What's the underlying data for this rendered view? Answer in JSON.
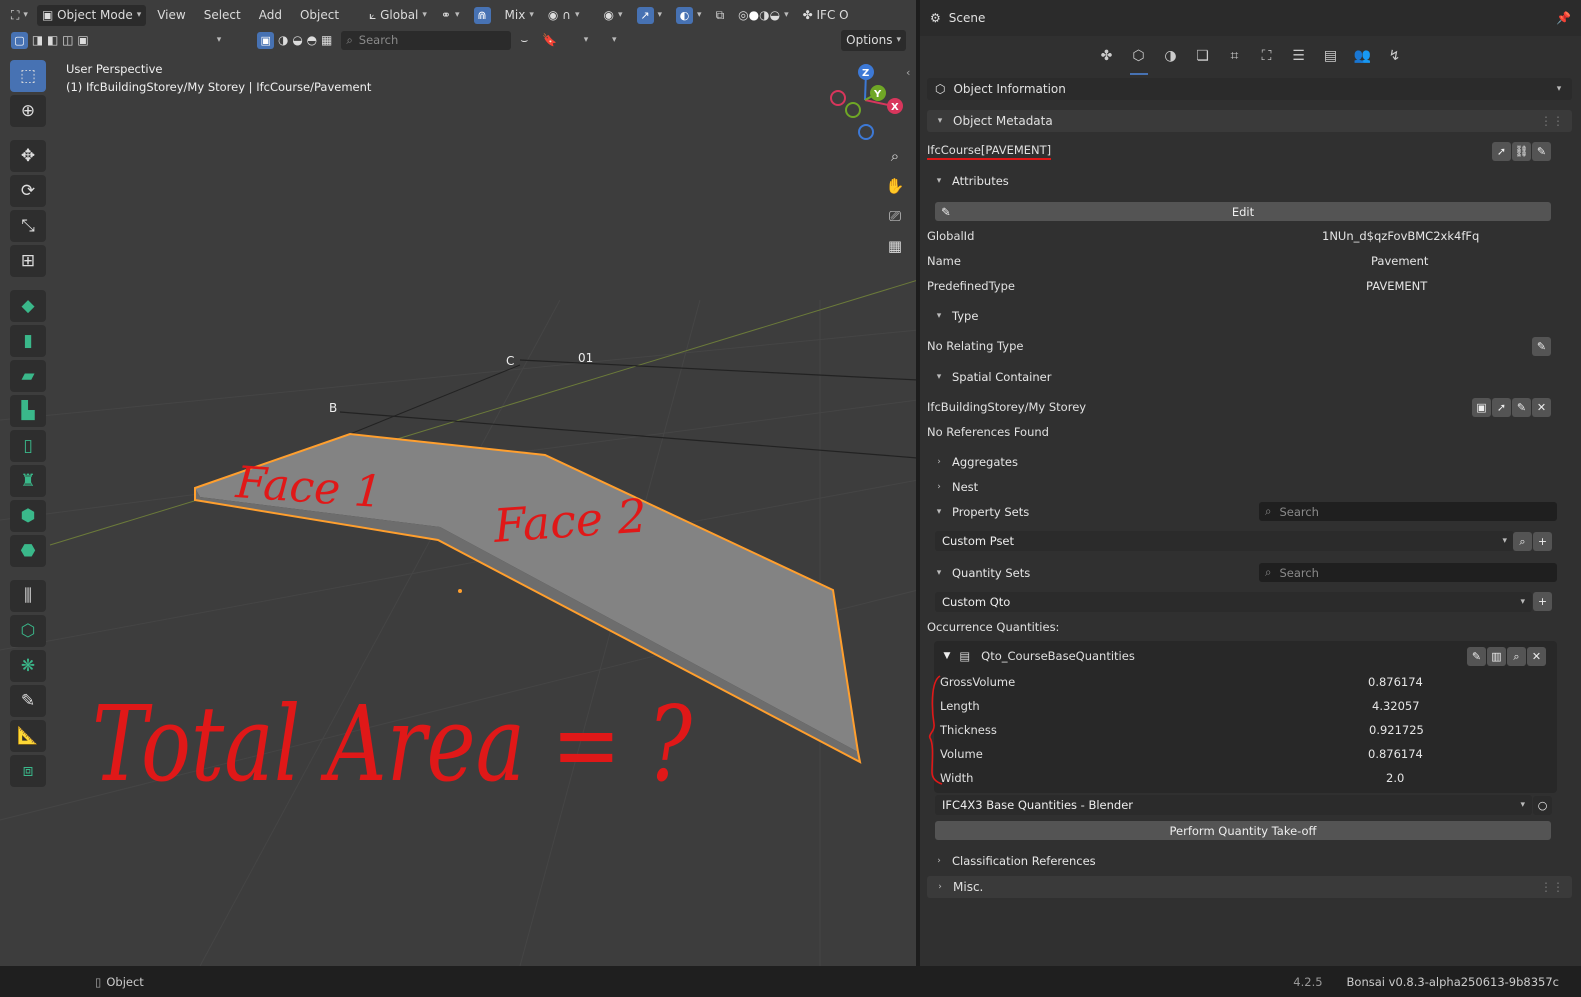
{
  "viewport": {
    "header": {
      "mode_label": "Object Mode",
      "menus": [
        "View",
        "Select",
        "Add",
        "Object"
      ],
      "orientation_label": "Global",
      "snap_label": "Mix",
      "addon_label": "IFC O",
      "search_placeholder": "Search",
      "options_label": "Options"
    },
    "info_line1": "User Perspective",
    "info_line2": "(1) IfcBuildingStorey/My Storey | IfcCourse/Pavement",
    "grid_labels": {
      "c": "C",
      "o1": "01",
      "b": "B"
    },
    "annotations": {
      "face1": "Face 1",
      "face2": "Face 2",
      "total_area": "Total Area = ?"
    },
    "gizmo": {
      "z": "Z",
      "y": "Y",
      "x": "X"
    }
  },
  "properties": {
    "header_title": "Scene",
    "object_information": "Object Information",
    "object_metadata": "Object Metadata",
    "entity_name": "IfcCourse[PAVEMENT]",
    "attributes": {
      "title": "Attributes",
      "edit_label": "Edit",
      "rows": [
        {
          "label": "GlobalId",
          "value": "1NUn_d$qzFovBMC2xk4fFq"
        },
        {
          "label": "Name",
          "value": "Pavement"
        },
        {
          "label": "PredefinedType",
          "value": "PAVEMENT"
        }
      ]
    },
    "type": {
      "title": "Type",
      "value": "No Relating Type"
    },
    "spatial": {
      "title": "Spatial Container",
      "container": "IfcBuildingStorey/My Storey",
      "refs": "No References Found"
    },
    "aggregates": "Aggregates",
    "nest": "Nest",
    "property_sets": {
      "title": "Property Sets",
      "search_placeholder": "Search",
      "dropdown": "Custom Pset"
    },
    "quantity_sets": {
      "title": "Quantity Sets",
      "search_placeholder": "Search",
      "dropdown": "Custom Qto",
      "occurrence_label": "Occurrence Quantities:",
      "qto_name": "Qto_CourseBaseQuantities",
      "rows": [
        {
          "label": "GrossVolume",
          "value": "0.876174"
        },
        {
          "label": "Length",
          "value": "4.32057"
        },
        {
          "label": "Thickness",
          "value": "0.921725"
        },
        {
          "label": "Volume",
          "value": "0.876174"
        },
        {
          "label": "Width",
          "value": "2.0"
        }
      ],
      "rule_dropdown": "IFC4X3 Base Quantities - Blender",
      "takeoff_label": "Perform Quantity Take-off"
    },
    "classification": "Classification References",
    "misc": "Misc."
  },
  "status_bar": {
    "mode": "Object",
    "version": "4.2.5",
    "addon_version": "Bonsai v0.8.3-alpha250613-9b8357c"
  },
  "colors": {
    "accent": "#4772b3",
    "selection_outline": "#ff9f2e",
    "annotation_red": "#e01818",
    "viewport_bg": "#3d3d3d",
    "panel_bg": "#303030"
  }
}
